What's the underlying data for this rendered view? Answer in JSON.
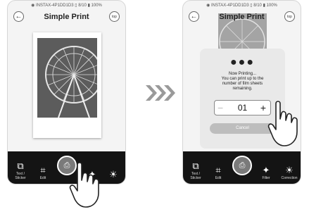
{
  "left": {
    "status": "◉ INSTAX-4P1DD1D3  ▯ 8/10  ▮ 100%",
    "title": "Simple Print",
    "back_icon": "←",
    "top_label": "top",
    "toolbar": [
      {
        "icon": "⧉",
        "label": "Text / Sticker"
      },
      {
        "icon": "⌗",
        "label": "Edit"
      },
      {
        "icon": "✦",
        "label": ""
      },
      {
        "icon": "☀",
        "label": ""
      }
    ],
    "print_icon": "⎙"
  },
  "right": {
    "status": "◉ INSTAX-4P1DD1D3  ▯ 8/10  ▮ 100%",
    "title": "Simple Print",
    "back_icon": "←",
    "top_label": "top",
    "dots": "●●●",
    "dialog_lines": [
      "Now Printing...",
      "You can print up to the",
      "number of film sheets",
      "remaining."
    ],
    "stepper": {
      "minus": "−",
      "value": "01",
      "plus": "+"
    },
    "cancel_label": "Cancel",
    "toolbar": [
      {
        "icon": "⧉",
        "label": "Text / Sticker"
      },
      {
        "icon": "⌗",
        "label": "Edit"
      },
      {
        "icon": "✦",
        "label": "Filter"
      },
      {
        "icon": "☀",
        "label": "Correction"
      }
    ],
    "print_icon": "⎙"
  },
  "colors": {
    "toolbar": "#141414",
    "dialog": "#e9e9e9",
    "cancel": "#bdbdbd"
  }
}
